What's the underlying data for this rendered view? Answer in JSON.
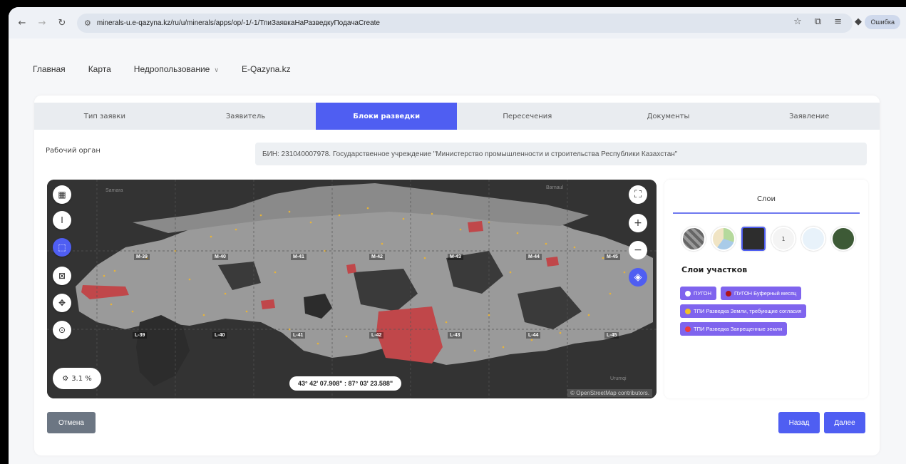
{
  "browser": {
    "url": "minerals-u.e-qazyna.kz/ru/u/minerals/apps/op/-1/-1/ТпиЗаявкаНаРазведкуПодачаCreate",
    "error_label": "Ошибка"
  },
  "topnav": {
    "items": [
      "Главная",
      "Карта",
      "Недропользование",
      "E-Qazyna.kz"
    ]
  },
  "tabs": [
    "Тип заявки",
    "Заявитель",
    "Блоки разведки",
    "Пересечения",
    "Документы",
    "Заявление"
  ],
  "active_tab": "Блоки разведки",
  "form": {
    "label": "Рабочий орган",
    "value": "БИН: 231040007978. Государственное учреждение \"Министерство промышленности и строительства Республики Казахстан\""
  },
  "map": {
    "zoom_percent": "3.1 %",
    "coordinates": "43° 42' 07.908\" : 87° 03' 23.588\"",
    "attribution": "© OpenStreetMap contributors.",
    "grid_labels_top": [
      "M-39",
      "M-40",
      "M-41",
      "M-42",
      "M-43",
      "M-44",
      "M-45"
    ],
    "grid_labels_bottom": [
      "L-39",
      "L-40",
      "L-41",
      "L-42",
      "L-43",
      "L-44",
      "L-45"
    ],
    "place_labels": [
      "Samara",
      "Barnaul",
      "Urumqi"
    ],
    "colors": {
      "background": "#333333",
      "land": "#9a9a9a",
      "restricted": "#c0474a",
      "points": "#e6b33a"
    }
  },
  "layers": {
    "title": "Слои",
    "subtitle": "Слои участков",
    "chips": [
      {
        "label": "ПУГОН",
        "color": "#ffffff"
      },
      {
        "label": "ПУГОН Буферный месяц",
        "color": "#b0141a"
      },
      {
        "label": "ТПИ Разведка Земли, требующие согласия",
        "color": "#f0c028"
      },
      {
        "label": "ТПИ Разведка Запрещенные земли",
        "color": "#ee3b3b"
      }
    ],
    "basemap_count_label": "1"
  },
  "buttons": {
    "cancel": "Отмена",
    "back": "Назад",
    "next": "Далее"
  }
}
